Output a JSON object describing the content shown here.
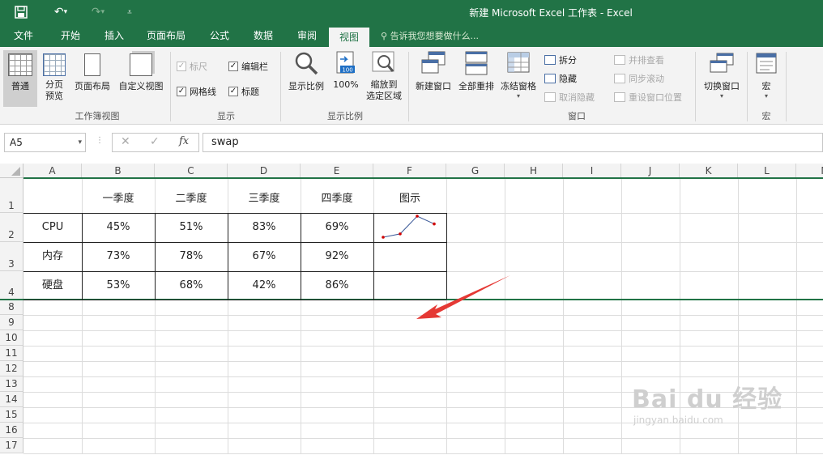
{
  "window": {
    "title": "新建 Microsoft Excel 工作表 - Excel"
  },
  "tabs": [
    "文件",
    "开始",
    "插入",
    "页面布局",
    "公式",
    "数据",
    "审阅",
    "视图"
  ],
  "active_tab": "视图",
  "tell_me": "告诉我您想要做什么...",
  "ribbon": {
    "workbook_views": {
      "normal": "普通",
      "page_break": "分页\n预览",
      "page_layout": "页面布局",
      "custom": "自定义视图",
      "label": "工作簿视图"
    },
    "show": {
      "ruler": "标尺",
      "formula_bar": "编辑栏",
      "gridlines": "网格线",
      "headings": "标题",
      "label": "显示"
    },
    "zoom": {
      "zoom": "显示比例",
      "hundred": "100%",
      "zoom_sel": "缩放到\n选定区域",
      "label": "显示比例"
    },
    "window": {
      "new_window": "新建窗口",
      "arrange_all": "全部重排",
      "freeze": "冻结窗格",
      "split": "拆分",
      "hide": "隐藏",
      "unhide": "取消隐藏",
      "side_by_side": "并排查看",
      "sync_scroll": "同步滚动",
      "reset_pos": "重设窗口位置",
      "switch": "切换窗口",
      "label": "窗口"
    },
    "macros": {
      "macro": "宏",
      "label": "宏"
    }
  },
  "formula_bar": {
    "name_box": "A5",
    "content": "swap"
  },
  "columns": [
    "A",
    "B",
    "C",
    "D",
    "E",
    "F",
    "G",
    "H",
    "I",
    "J",
    "K",
    "L",
    "M"
  ],
  "rows": [
    "1",
    "2",
    "3",
    "4",
    "8",
    "9",
    "10",
    "11",
    "12",
    "13",
    "14",
    "15",
    "16",
    "17"
  ],
  "table": {
    "headers": [
      "",
      "一季度",
      "二季度",
      "三季度",
      "四季度",
      "图示"
    ],
    "data": [
      [
        "CPU",
        "45%",
        "51%",
        "83%",
        "69%"
      ],
      [
        "内存",
        "73%",
        "78%",
        "67%",
        "92%"
      ],
      [
        "硬盘",
        "53%",
        "68%",
        "42%",
        "86%"
      ]
    ]
  },
  "sparkline": {
    "values": [
      45,
      51,
      83,
      69
    ],
    "color": "#3b5998",
    "marker_color": "#d00000"
  },
  "colors": {
    "brand": "#217346",
    "arrow": "#e53935"
  },
  "watermark": {
    "text": "Bai du 经验",
    "url": "jingyan.baidu.com"
  }
}
